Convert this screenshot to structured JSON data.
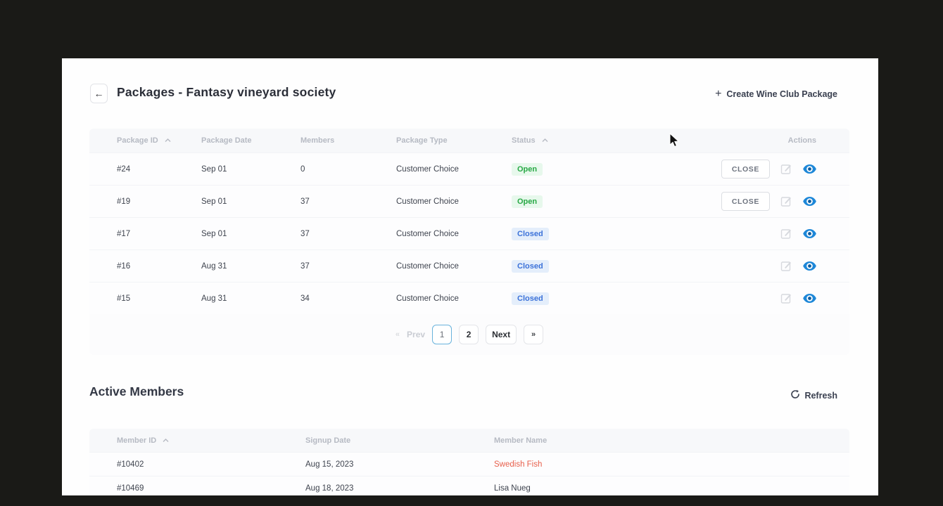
{
  "header": {
    "title": "Packages - Fantasy vineyard society",
    "back_icon": "←",
    "create_plus": "+",
    "create_label": "Create Wine Club Package"
  },
  "packages_table": {
    "columns": [
      "Package ID",
      "Package Date",
      "Members",
      "Package Type",
      "Status",
      "Actions"
    ],
    "close_button_label": "CLOSE",
    "rows": [
      {
        "id": "#24",
        "date": "Sep 01",
        "members": "0",
        "type": "Customer Choice",
        "status": "Open"
      },
      {
        "id": "#19",
        "date": "Sep 01",
        "members": "37",
        "type": "Customer Choice",
        "status": "Open"
      },
      {
        "id": "#17",
        "date": "Sep 01",
        "members": "37",
        "type": "Customer Choice",
        "status": "Closed"
      },
      {
        "id": "#16",
        "date": "Aug 31",
        "members": "37",
        "type": "Customer Choice",
        "status": "Closed"
      },
      {
        "id": "#15",
        "date": "Aug 31",
        "members": "34",
        "type": "Customer Choice",
        "status": "Closed"
      }
    ],
    "pagination": {
      "first": "«",
      "prev": "Prev",
      "page1": "1",
      "page2": "2",
      "next": "Next",
      "last": "»",
      "active_page": "1"
    }
  },
  "members_section": {
    "title": "Active Members",
    "refresh_label": "Refresh",
    "columns": [
      "Member ID",
      "Signup Date",
      "Member Name"
    ],
    "rows": [
      {
        "id": "#10402",
        "signup": "Aug 15, 2023",
        "name": "Swedish Fish"
      },
      {
        "id": "#10469",
        "signup": "Aug 18, 2023",
        "name": "Lisa Nueg"
      }
    ]
  },
  "icons": {
    "back": "arrow-left-icon",
    "create": "plus-icon",
    "sort": "caret-up-icon",
    "edit": "edit-square-icon",
    "view": "eye-icon",
    "refresh": "refresh-icon"
  },
  "colors": {
    "status_open_text": "#27a844",
    "status_open_bg": "#e7f8ec",
    "status_closed_text": "#3c72d9",
    "status_closed_bg": "#e4eefb",
    "eye_icon_blue": "#1d87d8",
    "member_name_alert": "#e8604c",
    "pagination_active_border": "#69b3dc",
    "outer_background": "#1a1a17"
  }
}
